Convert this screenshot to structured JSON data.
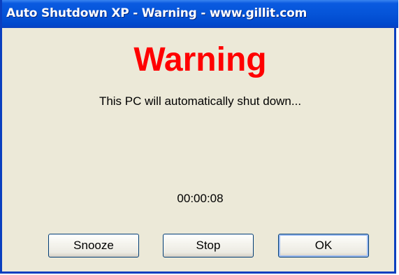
{
  "window": {
    "title": "Auto Shutdown XP - Warning - www.gillit.com"
  },
  "content": {
    "heading": "Warning",
    "message": "This PC will automatically shut down...",
    "countdown": "00:00:08"
  },
  "buttons": {
    "snooze_label": "Snooze",
    "stop_label": "Stop",
    "ok_label": "OK"
  },
  "colors": {
    "titlebar": "#0554d8",
    "window_bg": "#ece9d8",
    "heading": "#ff0000"
  }
}
